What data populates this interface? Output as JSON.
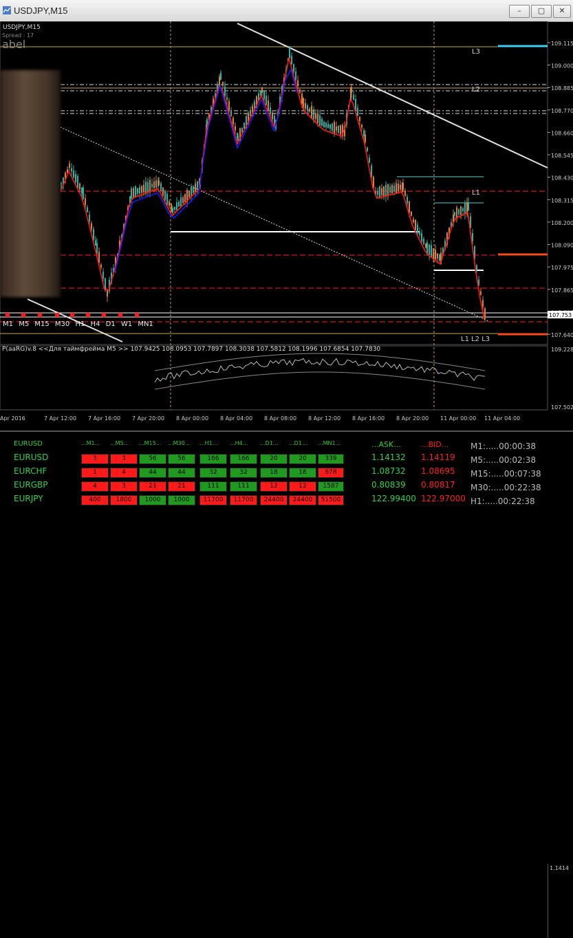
{
  "window": {
    "title": "USDJPY,M15",
    "buttons": [
      "–",
      "▢",
      "✕"
    ]
  },
  "chart": {
    "symbol_label": "USDJPY,M15",
    "spread_label": "Spread : 17",
    "label_text": "abel",
    "price_axis": [
      "109.115",
      "109.000",
      "108.885",
      "108.770",
      "108.660",
      "108.545",
      "108.430",
      "108.315",
      "108.200",
      "108.090",
      "107.975",
      "107.865",
      "107.755",
      "107.640"
    ],
    "price_marker": "107.753",
    "level_labels": {
      "l3_top": "L3",
      "l2": "L2",
      "l1": "L1",
      "bottom": "L1 L2 L3"
    },
    "time_axis": [
      "Apr 2016",
      "7 Apr 12:00",
      "7 Apr 16:00",
      "7 Apr 20:00",
      "8 Apr 00:00",
      "8 Apr 04:00",
      "8 Apr 08:00",
      "8 Apr 12:00",
      "8 Apr 16:00",
      "8 Apr 20:00",
      "11 Apr 00:00",
      "11 Apr 04:00"
    ],
    "timeframes": [
      "M1",
      "M5",
      "M15",
      "M30",
      "H1",
      "H4",
      "D1",
      "W1",
      "MN1"
    ],
    "indicator_label": "P(aaRG)v.8 <<Для таймфрейма M5 >> 107.9425 108.0953 107.7897 108.3038 107.5812 108.1996 107.6854 107.7830",
    "indicator_axis": [
      "109.228",
      "107.502"
    ],
    "colors": {
      "bull": "#d9823b",
      "bear": "#2bb3a6",
      "ma_red": "#ff1a1a",
      "ma_blue": "#1a1aff"
    }
  },
  "panel": {
    "pair_header": "EURUSD",
    "headers": [
      "...M1...",
      "...M5...",
      "...M15...",
      "...M30...",
      "...H1...",
      "...H4...",
      "...D1...",
      "...D1...",
      "...MN1..."
    ],
    "ask_header": "...ASK...",
    "bid_header": "...BID...",
    "rows": [
      {
        "sym": "EURUSD",
        "cells": [
          [
            "3",
            "r"
          ],
          [
            "3",
            "r"
          ],
          [
            "56",
            "g"
          ],
          [
            "56",
            "g"
          ],
          [
            "166",
            "g"
          ],
          [
            "166",
            "g"
          ],
          [
            "20",
            "g"
          ],
          [
            "20",
            "g"
          ],
          [
            "339",
            "g"
          ]
        ],
        "ask": "1.14132",
        "bid": "1.14119"
      },
      {
        "sym": "EURCHF",
        "cells": [
          [
            "1",
            "r"
          ],
          [
            "4",
            "r"
          ],
          [
            "44",
            "g"
          ],
          [
            "44",
            "g"
          ],
          [
            "32",
            "g"
          ],
          [
            "32",
            "g"
          ],
          [
            "18",
            "g"
          ],
          [
            "18",
            "g"
          ],
          [
            "678",
            "r"
          ]
        ],
        "ask": "1.08732",
        "bid": "1.08695"
      },
      {
        "sym": "EURGBP",
        "cells": [
          [
            "4",
            "r"
          ],
          [
            "3",
            "r"
          ],
          [
            "21",
            "r"
          ],
          [
            "21",
            "r"
          ],
          [
            "111",
            "g"
          ],
          [
            "111",
            "g"
          ],
          [
            "12",
            "r"
          ],
          [
            "12",
            "r"
          ],
          [
            "1587",
            "g"
          ]
        ],
        "ask": "0.80839",
        "bid": "0.80817"
      },
      {
        "sym": "EURJPY",
        "cells": [
          [
            "400",
            "r"
          ],
          [
            "1800",
            "r"
          ],
          [
            "1000",
            "g"
          ],
          [
            "1000",
            "g"
          ],
          [
            "11700",
            "r"
          ],
          [
            "11700",
            "r"
          ],
          [
            "24400",
            "r"
          ],
          [
            "24400",
            "r"
          ],
          [
            "51500",
            "r"
          ]
        ],
        "ask": "122.99400",
        "bid": "122.97000"
      }
    ],
    "timers": [
      "M1:.....00:00:38",
      "M5:.....00:02:38",
      "M15:.....00:07:38",
      "M30:.....00:22:38",
      "H1:.....00:22:38"
    ],
    "side_value": "1.1414"
  }
}
